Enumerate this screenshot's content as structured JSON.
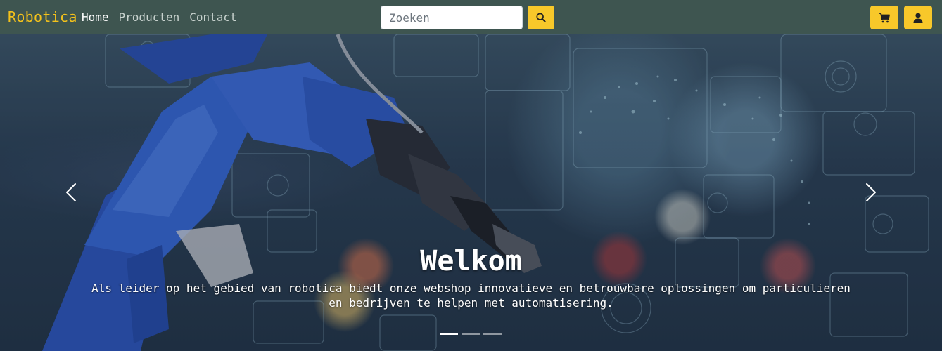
{
  "navbar": {
    "brand": "Robotica",
    "links": [
      "Home",
      "Producten",
      "Contact"
    ],
    "active_link": "Home",
    "search_placeholder": "Zoeken",
    "search_button_icon": "search-icon",
    "cart_icon": "cart-icon",
    "account_icon": "user-icon"
  },
  "hero": {
    "title": "Welkom",
    "text": "Als leider op het gebied van robotica biedt onze webshop innovatieve en betrouwbare oplossingen om particulieren en bedrijven te helpen met automatisering.",
    "prev_icon": "chevron-left-icon",
    "next_icon": "chevron-right-icon",
    "slide_count": 3,
    "active_slide": 1
  },
  "colors": {
    "navbar_bg": "#3e5550",
    "brand": "#f4c21b",
    "button_yellow": "#f8c82a"
  }
}
